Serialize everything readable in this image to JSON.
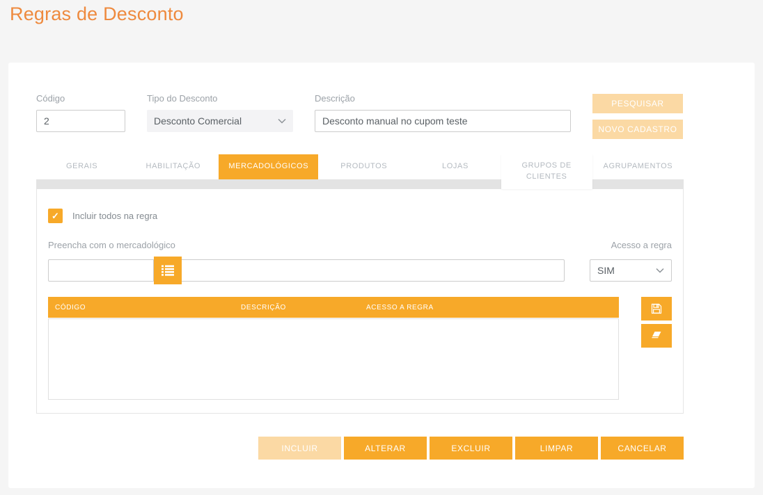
{
  "page": {
    "title": "Regras de Desconto"
  },
  "form": {
    "codigo": {
      "label": "Código",
      "value": "2"
    },
    "tipo_desconto": {
      "label": "Tipo do Desconto",
      "value": "Desconto Comercial"
    },
    "descricao": {
      "label": "Descrição",
      "value": "Desconto manual no cupom teste"
    },
    "pesquisar_label": "PESQUISAR",
    "novo_cadastro_label": "NOVO CADASTRO"
  },
  "tabs": [
    {
      "label": "GERAIS",
      "active": false
    },
    {
      "label": "HABILITAÇÃO",
      "active": false
    },
    {
      "label": "MERCADOLÓGICOS",
      "active": true
    },
    {
      "label": "PRODUTOS",
      "active": false
    },
    {
      "label": "LOJAS",
      "active": false
    },
    {
      "label": "GRUPOS DE CLIENTES",
      "active": false
    },
    {
      "label": "AGRUPAMENTOS",
      "active": false
    }
  ],
  "panel": {
    "include_all": {
      "label": "Incluir todos na regra",
      "checked": true,
      "check_glyph": "✓"
    },
    "mercadologico": {
      "label": "Preencha com o mercadológico",
      "code_value": "",
      "desc_value": ""
    },
    "acesso_regra": {
      "label": "Acesso a regra",
      "value": "SIM"
    },
    "table": {
      "headers": [
        "CÓDIGO",
        "DESCRIÇÃO",
        "ACESSO A REGRA"
      ],
      "rows": []
    }
  },
  "actions": {
    "incluir": "INCLUIR",
    "alterar": "ALTERAR",
    "excluir": "EXCLUIR",
    "limpar": "LIMPAR",
    "cancelar": "CANCELAR"
  },
  "colors": {
    "accent_orange": "#f7a929",
    "disabled_peach": "#fbd9a4",
    "title_orange": "#ee8a3e",
    "tab_inactive_text": "#b4bac0",
    "gray_strip": "#e3e3e3",
    "page_background": "#f5f5f5"
  }
}
